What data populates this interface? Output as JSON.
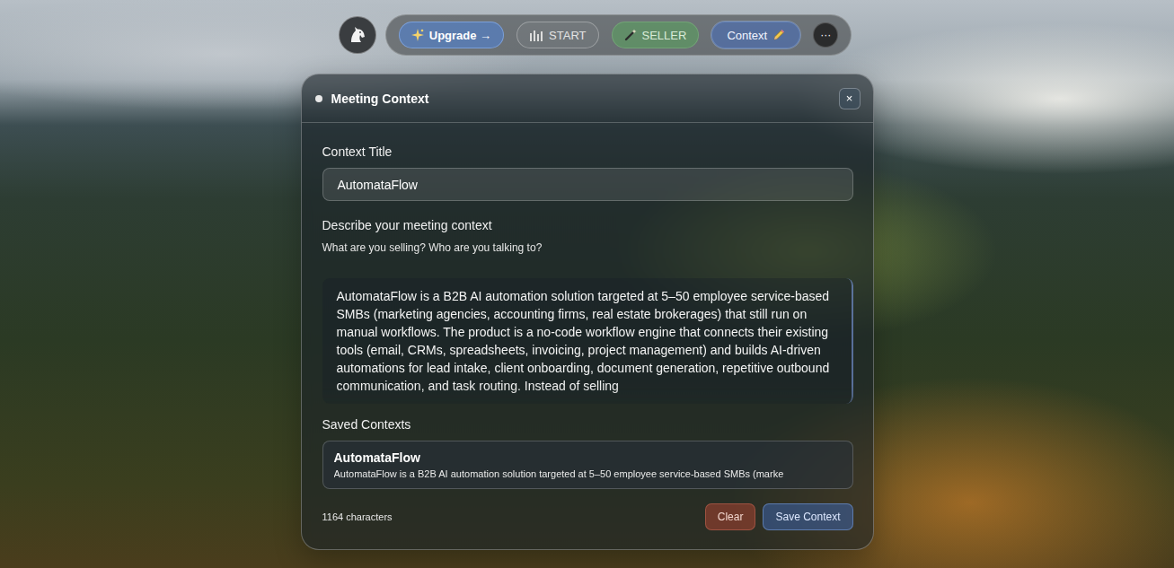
{
  "toolbar": {
    "items": [
      {
        "label": "Upgrade →",
        "kind": "upgrade",
        "selected": false
      },
      {
        "label": "START",
        "kind": "start",
        "selected": false
      },
      {
        "label": "SELLER",
        "kind": "mode",
        "selected": false
      },
      {
        "label": "Context",
        "kind": "context",
        "selected": true
      }
    ],
    "more": "···"
  },
  "panel": {
    "title": "Meeting Context",
    "close": "×",
    "title_field": {
      "label": "Context Title",
      "value": "AutomataFlow"
    },
    "description_field": {
      "label": "Describe your meeting context",
      "hint": "What are you selling? Who are you talking to?",
      "value": "AutomataFlow is a B2B AI automation solution targeted at 5–50 employee service-based SMBs (marketing agencies, accounting firms, real estate brokerages) that still run on manual workflows. The product is a no-code workflow engine that connects their existing tools (email, CRMs, spreadsheets, invoicing, project management) and builds AI-driven automations for lead intake, client onboarding, document generation, repetitive outbound communication, and task routing. Instead of selling"
    },
    "saved": {
      "label": "Saved Contexts",
      "items": [
        {
          "title": "AutomataFlow",
          "description": "AutomataFlow is a B2B AI automation solution targeted at 5–50 employee service-based SMBs (marke"
        }
      ]
    },
    "char_count": "1164 characters",
    "buttons": [
      {
        "label": "Clear",
        "kind": "clear"
      },
      {
        "label": "Save Context",
        "kind": "save"
      }
    ]
  }
}
